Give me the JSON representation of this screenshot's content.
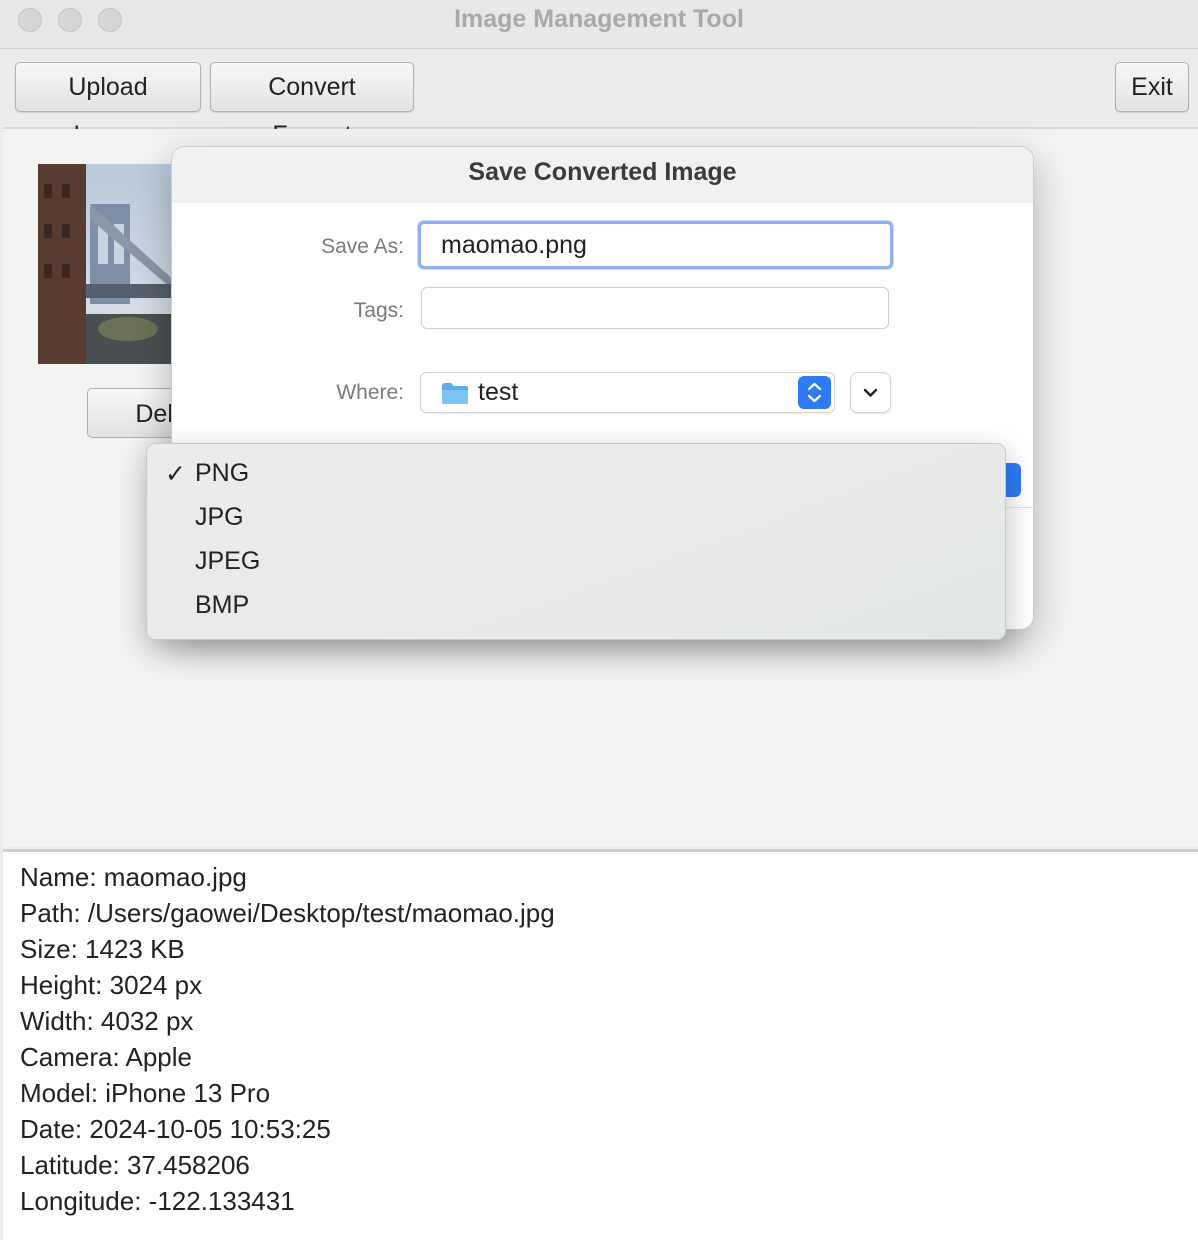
{
  "window": {
    "title": "Image Management Tool"
  },
  "toolbar": {
    "upload_label": "Upload Image",
    "convert_label": "Convert Format",
    "exit_label": "Exit"
  },
  "gallery": {
    "delete_label": "Delete"
  },
  "dialog": {
    "title": "Save Converted Image",
    "save_as_label": "Save As:",
    "save_as_value": "maomao.png",
    "tags_label": "Tags:",
    "tags_value": "",
    "where_label": "Where:",
    "where_value": "test",
    "accent_color": "#2f7bf5"
  },
  "format_menu": {
    "selected": "PNG",
    "options": [
      {
        "label": "PNG",
        "checked": "✓"
      },
      {
        "label": "JPG",
        "checked": ""
      },
      {
        "label": "JPEG",
        "checked": ""
      },
      {
        "label": "BMP",
        "checked": ""
      }
    ]
  },
  "info": {
    "lines": [
      "Name: maomao.jpg",
      "Path: /Users/gaowei/Desktop/test/maomao.jpg",
      "Size: 1423 KB",
      "Height: 3024 px",
      "Width: 4032 px",
      "Camera: Apple",
      "Model: iPhone 13 Pro",
      "Date: 2024-10-05 10:53:25",
      "Latitude: 37.458206",
      "Longitude: -122.133431"
    ]
  }
}
